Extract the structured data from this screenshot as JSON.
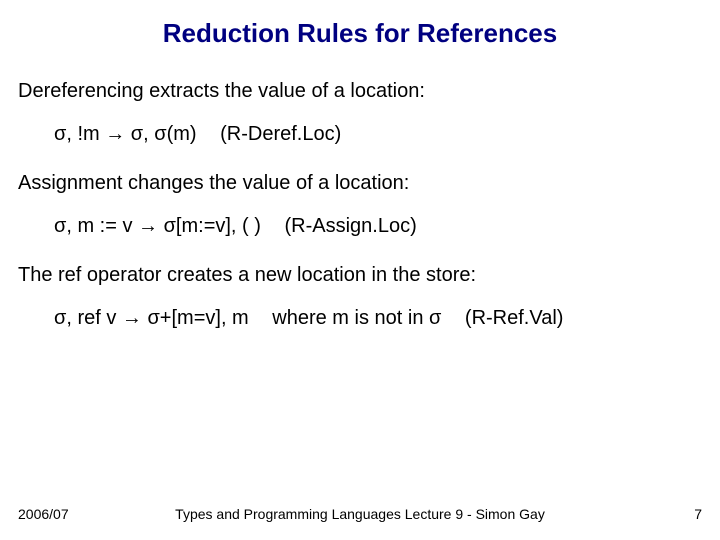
{
  "title": "Reduction Rules for References",
  "para1": "Dereferencing extracts the value of a location:",
  "rule1_expr": "σ, !m → σ, σ(m)",
  "rule1_name": "(R-Deref.Loc)",
  "para2": "Assignment changes the value of a location:",
  "rule2_expr": "σ, m := v → σ[m:=v], ( )",
  "rule2_name": "(R-Assign.Loc)",
  "para3": "The ref operator creates a new location in the store:",
  "rule3_expr": "σ, ref v → σ+[m=v], m",
  "rule3_cond": "where m is not in σ",
  "rule3_name": "(R-Ref.Val)",
  "footer_year": "2006/07",
  "footer_center": "Types and Programming Languages Lecture 9 - Simon Gay",
  "footer_page": "7"
}
